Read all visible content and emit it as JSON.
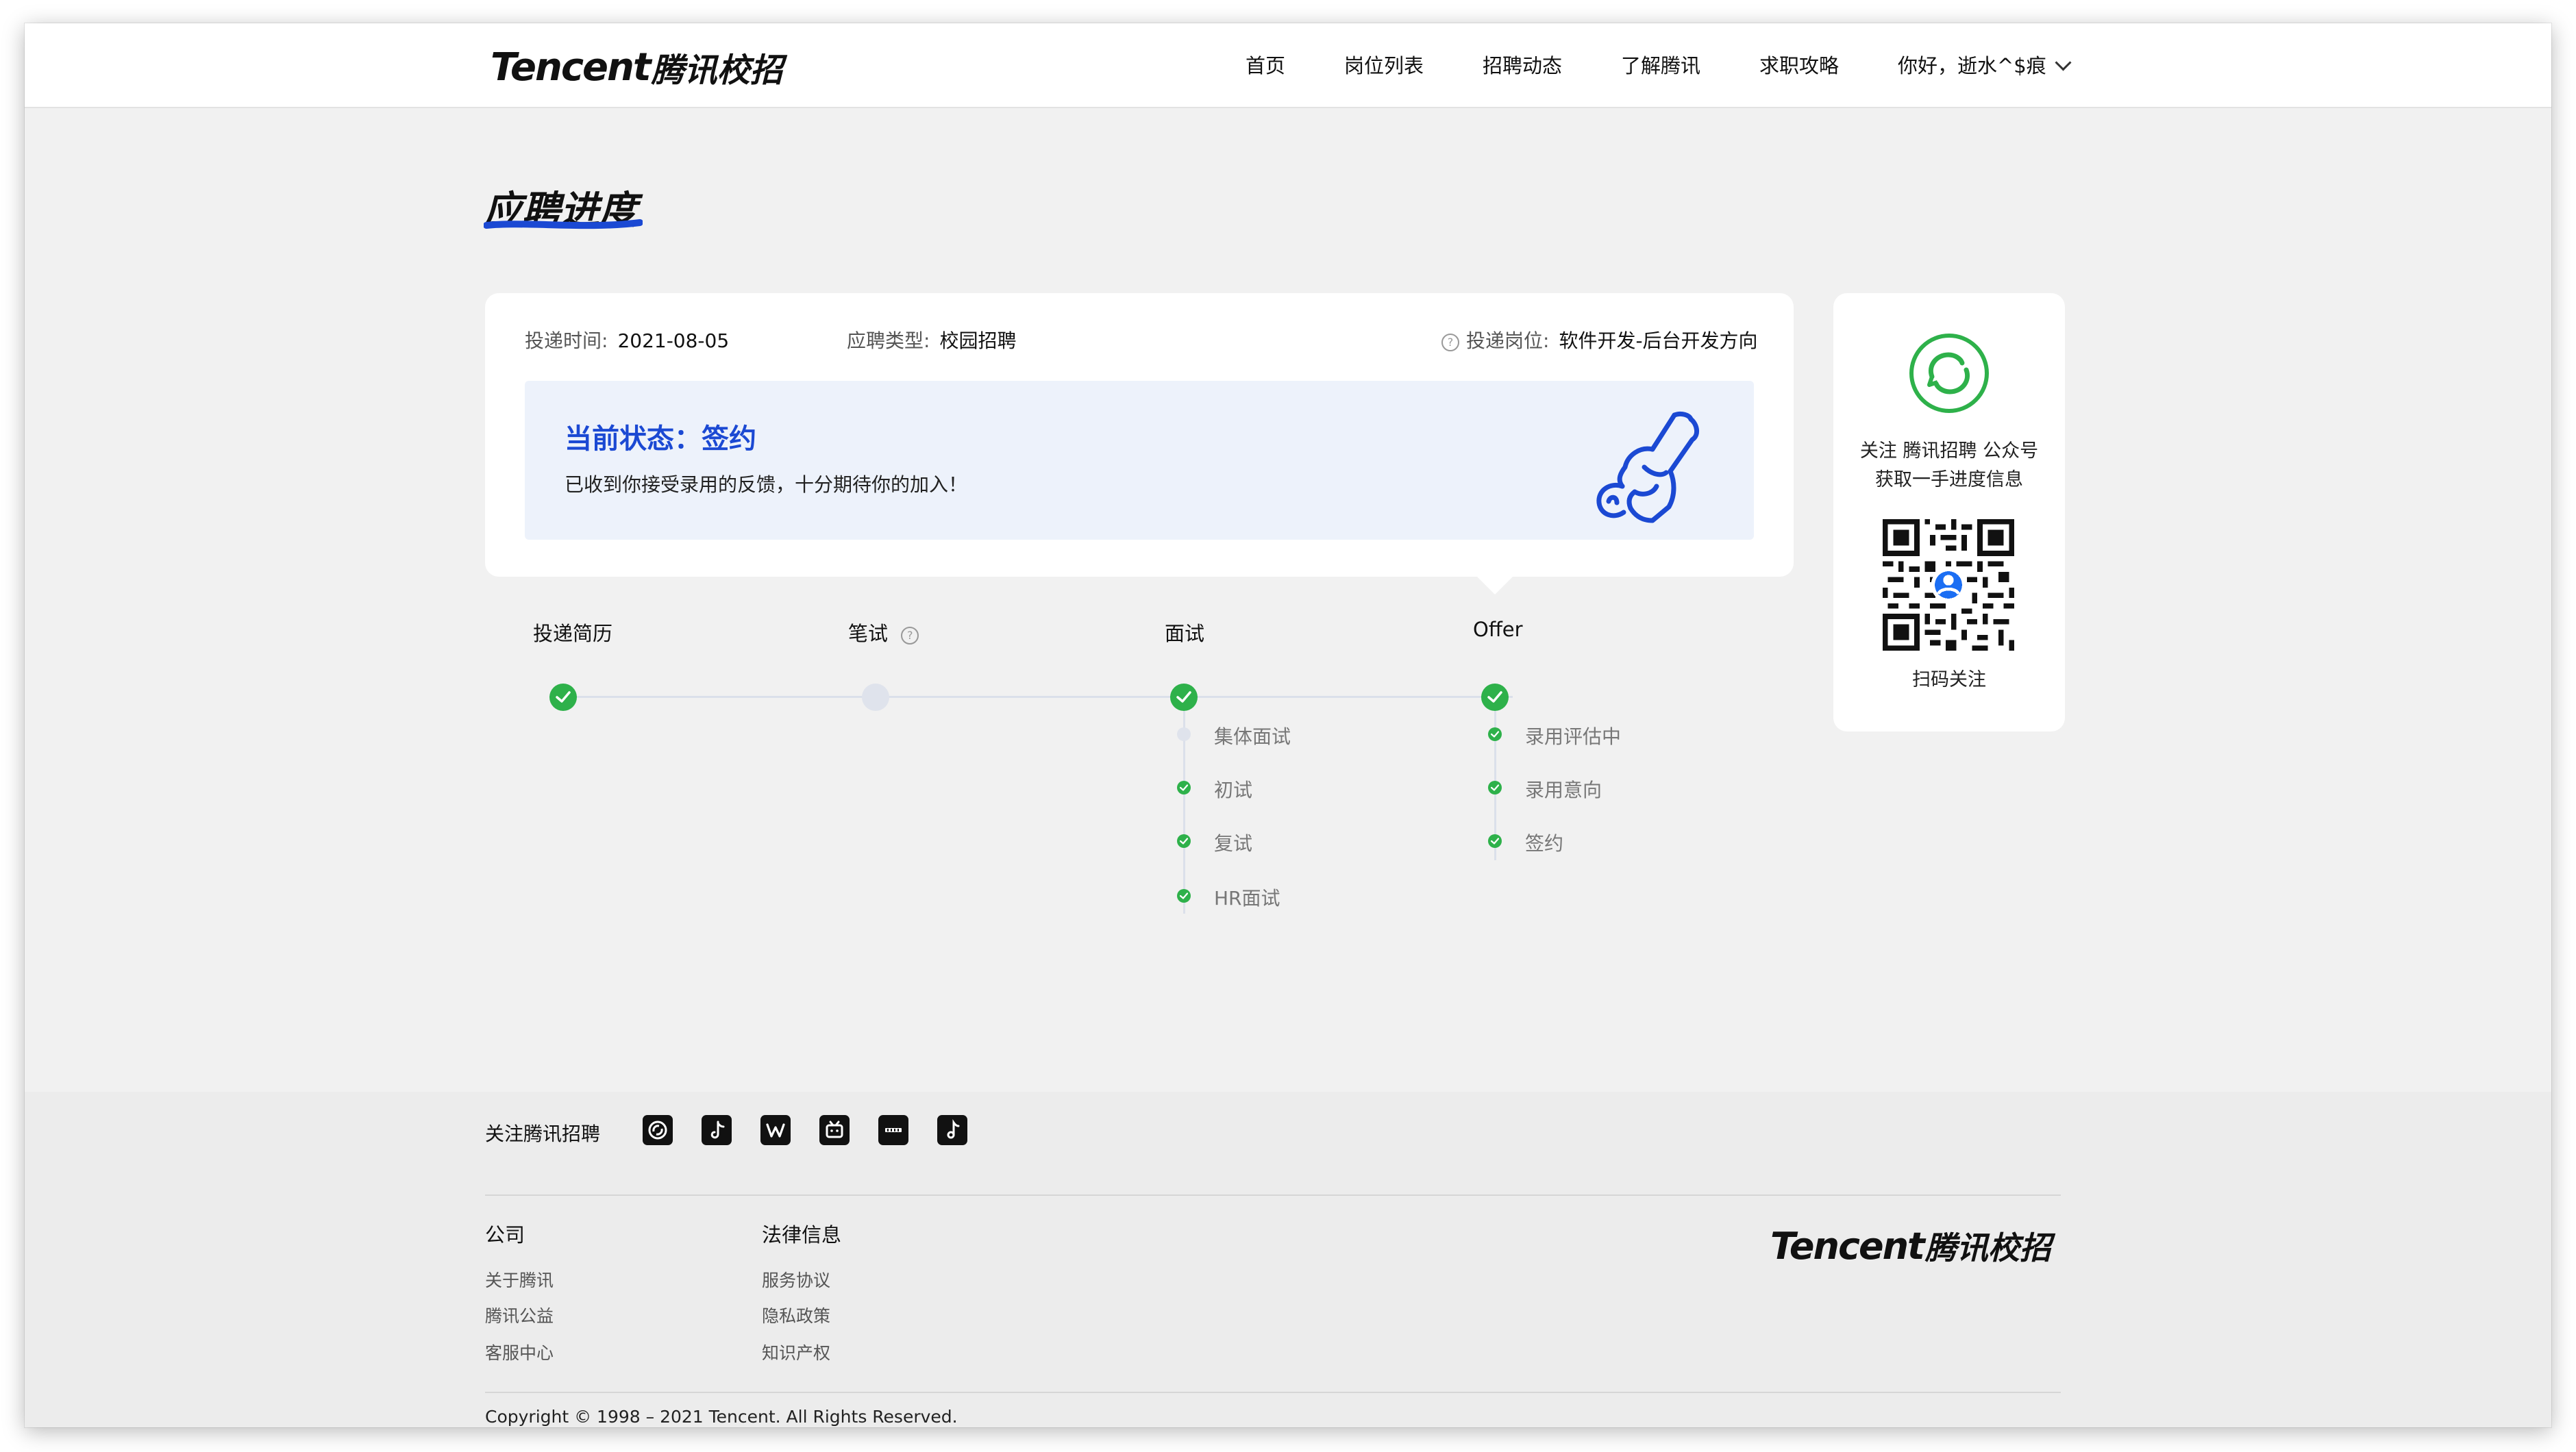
{
  "header": {
    "logo_en": "Tencent",
    "logo_cn": "腾讯校招",
    "nav": [
      "首页",
      "岗位列表",
      "招聘动态",
      "了解腾讯",
      "求职攻略"
    ],
    "user_greeting": "你好，逝水^$痕"
  },
  "page": {
    "title": "应聘进度"
  },
  "application": {
    "submit_time_label": "投递时间:",
    "submit_time": "2021-08-05",
    "type_label": "应聘类型:",
    "type": "校园招聘",
    "position_label": "投递岗位:",
    "position": "软件开发-后台开发方向"
  },
  "status": {
    "title": "当前状态：签约",
    "description": "已收到你接受录用的反馈，十分期待你的加入！"
  },
  "progress": {
    "stages": [
      {
        "label": "投递简历",
        "state": "done",
        "substeps": []
      },
      {
        "label": "笔试",
        "state": "pending",
        "help": true,
        "substeps": []
      },
      {
        "label": "面试",
        "state": "done",
        "substeps": [
          {
            "label": "集体面试",
            "state": "pending"
          },
          {
            "label": "初试",
            "state": "done"
          },
          {
            "label": "复试",
            "state": "done"
          },
          {
            "label": "HR面试",
            "state": "done"
          }
        ]
      },
      {
        "label": "Offer",
        "state": "done",
        "substeps": [
          {
            "label": "录用评估中",
            "state": "done"
          },
          {
            "label": "录用意向",
            "state": "done"
          },
          {
            "label": "签约",
            "state": "done"
          }
        ]
      }
    ]
  },
  "qr_card": {
    "line1": "关注 腾讯招聘 公众号",
    "line2": "获取一手进度信息",
    "scan_label": "扫码关注"
  },
  "footer": {
    "follow_label": "关注腾讯招聘",
    "social_icons": [
      "wechat-icon",
      "douyin-icon",
      "weibo-icon",
      "bilibili-icon",
      "xiaohongshu-icon",
      "tiktok-icon"
    ],
    "col_company": {
      "title": "公司",
      "links": [
        "关于腾讯",
        "腾讯公益",
        "客服中心"
      ]
    },
    "col_legal": {
      "title": "法律信息",
      "links": [
        "服务协议",
        "隐私政策",
        "知识产权"
      ]
    },
    "logo_en": "Tencent",
    "logo_cn": "腾讯校招",
    "copyright": "Copyright © 1998 – 2021 Tencent. All Rights Reserved."
  },
  "colors": {
    "accent_blue": "#1b49d3",
    "success_green": "#2eb14a",
    "pending_grey": "#dfe3ec"
  }
}
